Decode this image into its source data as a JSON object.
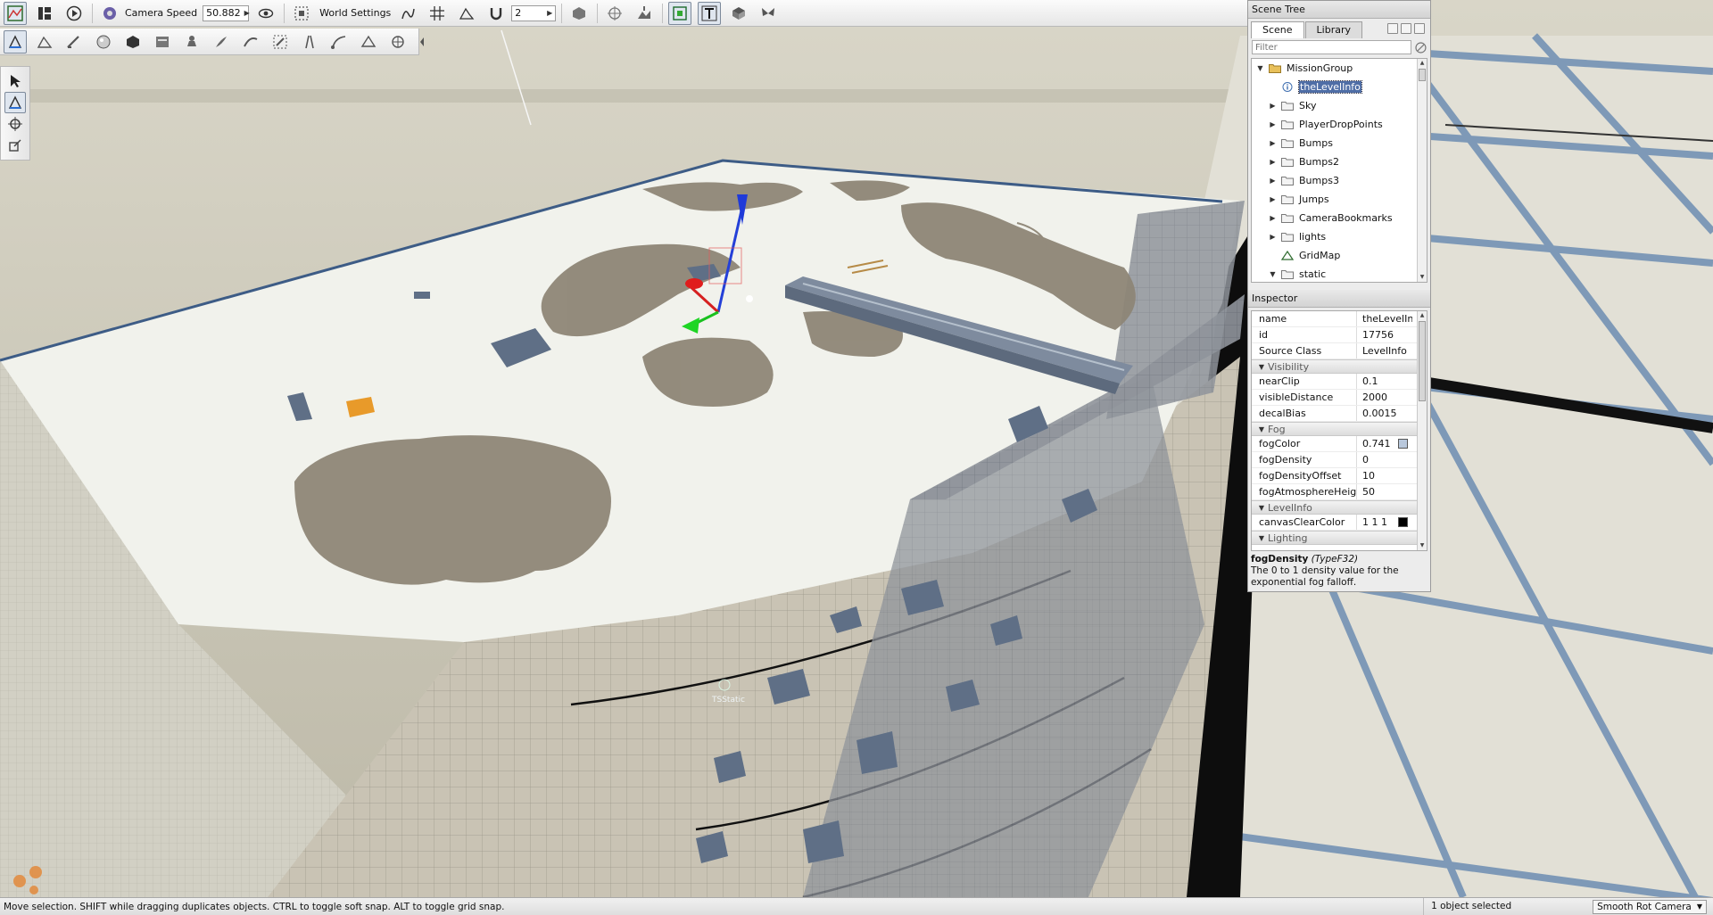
{
  "toolbar": {
    "camera_speed_label": "Camera Speed",
    "camera_speed_value": "50.882",
    "world_settings_label": "World Settings",
    "snap_value": "2"
  },
  "viewport": {
    "spawn_label": "TSStatic"
  },
  "scene_tree": {
    "title": "Scene Tree",
    "tabs": [
      "Scene",
      "Library"
    ],
    "active_tab": "Scene",
    "filter_placeholder": "Filter",
    "items": [
      {
        "label": "MissionGroup",
        "icon": "folder-open-icon",
        "depth": 0,
        "expander": "expanded"
      },
      {
        "label": "theLevelInfo",
        "icon": "info-icon",
        "depth": 1,
        "expander": "none",
        "selected": true
      },
      {
        "label": "Sky",
        "icon": "folder-icon",
        "depth": 1,
        "expander": "collapsed"
      },
      {
        "label": "PlayerDropPoints",
        "icon": "folder-icon",
        "depth": 1,
        "expander": "collapsed"
      },
      {
        "label": "Bumps",
        "icon": "folder-icon",
        "depth": 1,
        "expander": "collapsed"
      },
      {
        "label": "Bumps2",
        "icon": "folder-icon",
        "depth": 1,
        "expander": "collapsed"
      },
      {
        "label": "Bumps3",
        "icon": "folder-icon",
        "depth": 1,
        "expander": "collapsed"
      },
      {
        "label": "Jumps",
        "icon": "folder-icon",
        "depth": 1,
        "expander": "collapsed"
      },
      {
        "label": "CameraBookmarks",
        "icon": "folder-icon",
        "depth": 1,
        "expander": "collapsed"
      },
      {
        "label": "lights",
        "icon": "folder-icon",
        "depth": 1,
        "expander": "collapsed"
      },
      {
        "label": "GridMap",
        "icon": "terrain-icon",
        "depth": 1,
        "expander": "none"
      },
      {
        "label": "static",
        "icon": "folder-icon",
        "depth": 1,
        "expander": "expanded"
      }
    ]
  },
  "inspector": {
    "title": "Inspector",
    "rows": [
      {
        "kind": "prop",
        "name": "name",
        "value": "theLevelInfo"
      },
      {
        "kind": "prop",
        "name": "id",
        "value": "17756"
      },
      {
        "kind": "prop",
        "name": "Source Class",
        "value": "LevelInfo"
      },
      {
        "kind": "group",
        "name": "Visibility"
      },
      {
        "kind": "prop",
        "name": "nearClip",
        "value": "0.1"
      },
      {
        "kind": "prop",
        "name": "visibleDistance",
        "value": "2000"
      },
      {
        "kind": "prop",
        "name": "decalBias",
        "value": "0.0015"
      },
      {
        "kind": "group",
        "name": "Fog"
      },
      {
        "kind": "prop",
        "name": "fogColor",
        "value": "0.741",
        "swatch": "#b9c8dc"
      },
      {
        "kind": "prop",
        "name": "fogDensity",
        "value": "0"
      },
      {
        "kind": "prop",
        "name": "fogDensityOffset",
        "value": "10"
      },
      {
        "kind": "prop",
        "name": "fogAtmosphereHeight",
        "value": "50"
      },
      {
        "kind": "group",
        "name": "LevelInfo"
      },
      {
        "kind": "prop",
        "name": "canvasClearColor",
        "value": "1 1 1",
        "swatch": "#000000"
      },
      {
        "kind": "group",
        "name": "Lighting"
      }
    ],
    "doc_title": "fogDensity",
    "doc_type": "(TypeF32)",
    "doc_text": "The 0 to 1 density value for the exponential fog falloff."
  },
  "status_bar": {
    "text": "Move selection.  SHIFT while dragging duplicates objects.  CTRL to toggle soft snap.  ALT to toggle grid snap.",
    "selection": "1 object selected",
    "camera_mode": "Smooth Rot Camera"
  },
  "colors": {
    "selection": "#4f6ea6",
    "sky": "#c8c5b5",
    "ground": "#e2e0d6"
  }
}
